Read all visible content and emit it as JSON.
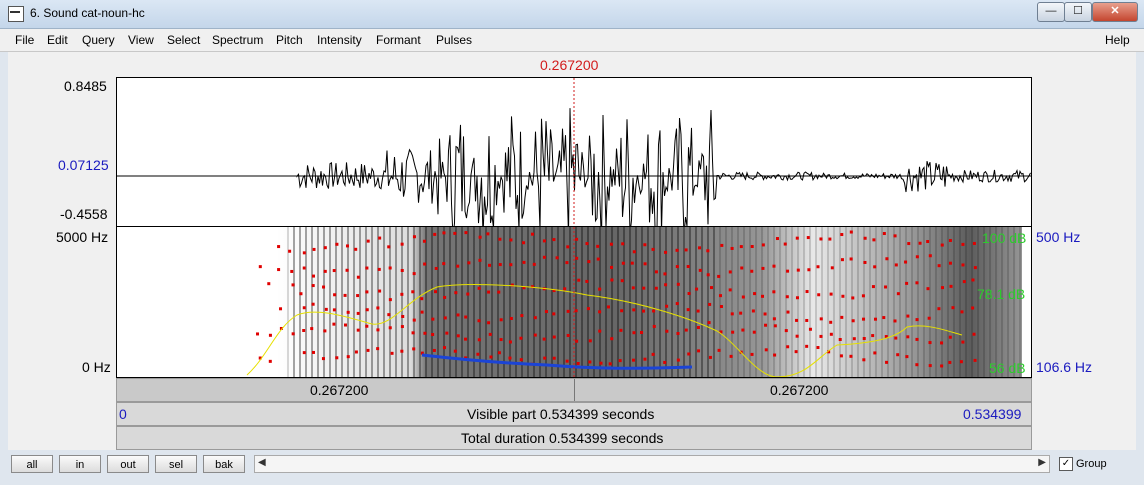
{
  "window": {
    "title": "6. Sound cat-noun-hc",
    "controls": {
      "minimize": "—",
      "maximize": "☐",
      "close": "✕"
    }
  },
  "menu": [
    "File",
    "Edit",
    "Query",
    "View",
    "Select",
    "Spectrum",
    "Pitch",
    "Intensity",
    "Formant",
    "Pulses"
  ],
  "menu_help": "Help",
  "cursor": {
    "time_label": "0.267200"
  },
  "waveform": {
    "max_label": "0.8485",
    "mid_label": "0.07125",
    "min_label": "-0.4558"
  },
  "spectrogram": {
    "top_label": "5000 Hz",
    "bottom_label": "0 Hz",
    "intensity_top": "100 dB",
    "intensity_mid": "78.1 dB",
    "intensity_bottom": "56 dB",
    "pitch_top": "500 Hz",
    "pitch_bottom": "106.6 Hz"
  },
  "time_strip": {
    "left": "0.267200",
    "right": "0.267200"
  },
  "visible_strip": {
    "start": "0",
    "label": "Visible part 0.534399 seconds",
    "end": "0.534399"
  },
  "total_strip": {
    "label": "Total duration 0.534399 seconds"
  },
  "buttons": {
    "all": "all",
    "in": "in",
    "out": "out",
    "sel": "sel",
    "bak": "bak"
  },
  "scroll_arrows": {
    "left": "◀",
    "right": "▶"
  },
  "group": {
    "label": "Group",
    "checked": "✓"
  },
  "colors": {
    "cursor": "#d21c1c",
    "pitch": "#1b44d6",
    "intensity": "#e6e000",
    "formant": "#e00000",
    "db_label": "#2ccc2c",
    "axis_blue": "#1a1abf"
  }
}
